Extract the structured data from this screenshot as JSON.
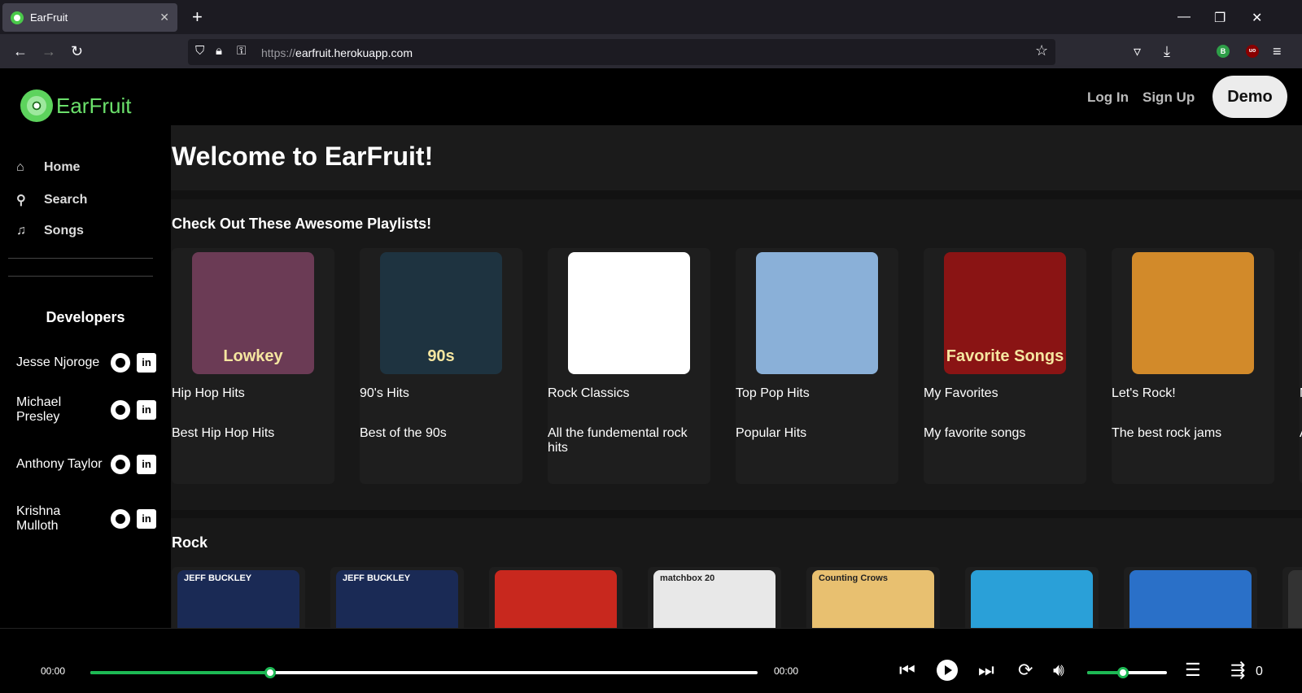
{
  "browser": {
    "tab_title": "EarFruit",
    "tab_close": "✕",
    "new_tab": "+",
    "url_prefix": "https://",
    "url_host": "earfruit.herokuapp.com",
    "window_controls": [
      "—",
      "❐",
      "✕"
    ],
    "ext_b": "B",
    "ext_u": "uo"
  },
  "sidebar": {
    "logo_text": "EarFruit",
    "nav": [
      {
        "label": "Home",
        "icon": "home-icon"
      },
      {
        "label": "Search",
        "icon": "search-icon"
      },
      {
        "label": "Songs",
        "icon": "music-note-icon"
      }
    ],
    "developers_title": "Developers",
    "developers": [
      {
        "name": "Jesse Njoroge"
      },
      {
        "name": "Michael Presley"
      },
      {
        "name": "Anthony Taylor"
      },
      {
        "name": "Krishna Mulloth"
      }
    ],
    "linkedin_glyph": "in"
  },
  "header": {
    "login": "Log In",
    "signup": "Sign Up",
    "demo": "Demo"
  },
  "main": {
    "welcome": "Welcome to EarFruit!",
    "playlists_title": "Check Out These Awesome Playlists!",
    "playlists": [
      {
        "name": "Hip Hop Hits",
        "description": "Best Hip Hop Hits",
        "cover_text": "Lowkey",
        "cover_color": "#6b3b55"
      },
      {
        "name": "90's Hits",
        "description": "Best of the 90s",
        "cover_text": "90s",
        "cover_color": "#1e3340"
      },
      {
        "name": "Rock Classics",
        "description": "All the fundemental rock hits",
        "cover_text": "",
        "cover_color": "#ffffff"
      },
      {
        "name": "Top Pop Hits",
        "description": "Popular Hits",
        "cover_text": "",
        "cover_color": "#8ab0d8"
      },
      {
        "name": "My Favorites",
        "description": "My favorite songs",
        "cover_text": "Favorite Songs",
        "cover_color": "#8a1414"
      },
      {
        "name": "Let's Rock!",
        "description": "The best rock jams",
        "cover_text": "",
        "cover_color": "#d28a2a"
      },
      {
        "name": "M",
        "description": "A b",
        "cover_text": "",
        "cover_color": "#1e1e1e"
      }
    ],
    "rock_title": "Rock",
    "rock_covers": [
      {
        "cover_text": "JEFF BUCKLEY",
        "color": "#1a2a55"
      },
      {
        "cover_text": "JEFF BUCKLEY",
        "color": "#1a2a55"
      },
      {
        "cover_text": "",
        "color": "#c8281e"
      },
      {
        "cover_text": "matchbox 20",
        "color": "#e8e8e8"
      },
      {
        "cover_text": "Counting Crows",
        "color": "#e8c070"
      },
      {
        "cover_text": "",
        "color": "#2aa0d8"
      },
      {
        "cover_text": "",
        "color": "#2a70c8"
      },
      {
        "cover_text": "",
        "color": "#333333"
      }
    ]
  },
  "player": {
    "current_time": "00:00",
    "total_time": "00:00",
    "progress": 0.27,
    "volume": 0.45,
    "queue_count": "0"
  },
  "colors": {
    "accent": "#1db954",
    "logo_green": "#6be06b"
  }
}
